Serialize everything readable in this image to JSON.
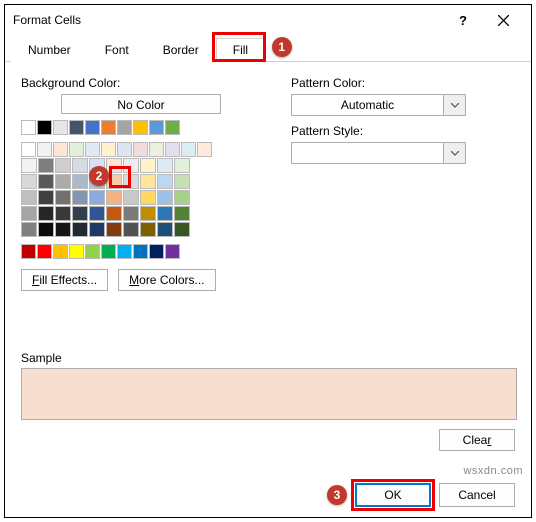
{
  "window": {
    "title": "Format Cells"
  },
  "tabs": {
    "number": "Number",
    "font": "Font",
    "border": "Border",
    "fill": "Fill",
    "active": "Fill"
  },
  "labels": {
    "backgroundColor": "Background Color:",
    "noColor": "No Color",
    "patternColor": "Pattern Color:",
    "patternStyle": "Pattern Style:",
    "sample": "Sample"
  },
  "buttons": {
    "fillEffectsPrefix": "F",
    "fillEffectsRest": "ill Effects...",
    "moreColorsPrefix": "M",
    "moreColorsRest": "ore Colors...",
    "clearPrefix": "Clea",
    "clearSuffix": "r",
    "ok": "OK",
    "cancel": "Cancel"
  },
  "dropdowns": {
    "patternColor": "Automatic",
    "patternStyle": ""
  },
  "callouts": {
    "c1": "1",
    "c2": "2",
    "c3": "3"
  },
  "sample": {
    "color": "#f7dece"
  },
  "selectedSwatch": "#dce6f1",
  "colors": {
    "basicRow": [
      "#ffffff",
      "#000000",
      "#e7e6e6",
      "#44546a",
      "#4472c4",
      "#ed7d31",
      "#a5a5a5",
      "#ffc000",
      "#5b9bd5",
      "#70ad47"
    ],
    "themeGrid": [
      [
        "#f2f2f2",
        "#7f7f7f",
        "#d0cece",
        "#d6dce4",
        "#d9e1f2",
        "#fce4d6",
        "#ededed",
        "#fff2cc",
        "#ddebf7",
        "#e2efda"
      ],
      [
        "#d9d9d9",
        "#595959",
        "#aeaaaa",
        "#acb9ca",
        "#b4c6e7",
        "#f8cbad",
        "#dbdbdb",
        "#ffe699",
        "#bdd7ee",
        "#c5e0b3"
      ],
      [
        "#bfbfbf",
        "#404040",
        "#757070",
        "#8496b0",
        "#8ea9db",
        "#f4b183",
        "#c9c9c9",
        "#ffd966",
        "#9cc3e6",
        "#a8d08d"
      ],
      [
        "#a6a6a6",
        "#262626",
        "#3a3838",
        "#323f4f",
        "#305496",
        "#c65911",
        "#7b7b7b",
        "#bf8f00",
        "#2e75b5",
        "#538135"
      ],
      [
        "#808080",
        "#0c0c0c",
        "#171616",
        "#222a35",
        "#1f3864",
        "#833c0b",
        "#525252",
        "#7f6000",
        "#1e4e79",
        "#375623"
      ]
    ],
    "lightTintRow": [
      "#ffffff",
      "#f2f2f2",
      "#fbe5d6",
      "#e2f0d9",
      "#deebf7",
      "#fff2cc",
      "#dce6f1",
      "#f2dcdb",
      "#ebf1de",
      "#e4dfec",
      "#dbeef4",
      "#fdeada"
    ],
    "standardRow": [
      "#c00000",
      "#ff0000",
      "#ffc000",
      "#ffff00",
      "#92d050",
      "#00b050",
      "#00b0f0",
      "#0070c0",
      "#002060",
      "#7030a0"
    ]
  },
  "watermark": "wsxdn.com"
}
